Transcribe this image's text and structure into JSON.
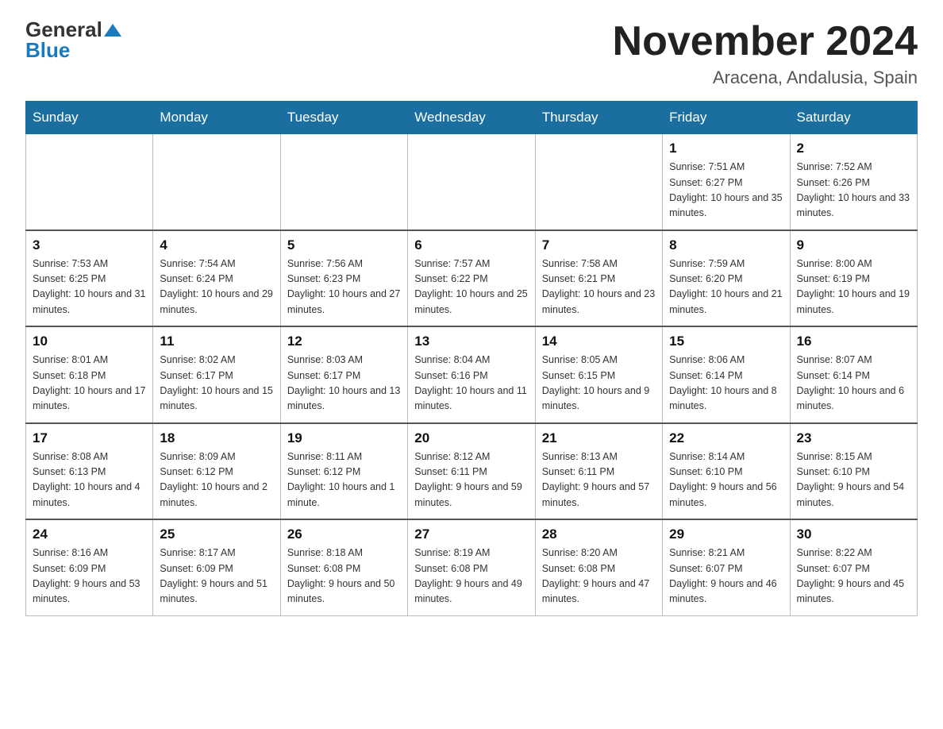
{
  "header": {
    "logo_general": "General",
    "logo_blue": "Blue",
    "month": "November 2024",
    "location": "Aracena, Andalusia, Spain"
  },
  "weekdays": [
    "Sunday",
    "Monday",
    "Tuesday",
    "Wednesday",
    "Thursday",
    "Friday",
    "Saturday"
  ],
  "weeks": [
    [
      {
        "day": "",
        "info": ""
      },
      {
        "day": "",
        "info": ""
      },
      {
        "day": "",
        "info": ""
      },
      {
        "day": "",
        "info": ""
      },
      {
        "day": "",
        "info": ""
      },
      {
        "day": "1",
        "info": "Sunrise: 7:51 AM\nSunset: 6:27 PM\nDaylight: 10 hours and 35 minutes."
      },
      {
        "day": "2",
        "info": "Sunrise: 7:52 AM\nSunset: 6:26 PM\nDaylight: 10 hours and 33 minutes."
      }
    ],
    [
      {
        "day": "3",
        "info": "Sunrise: 7:53 AM\nSunset: 6:25 PM\nDaylight: 10 hours and 31 minutes."
      },
      {
        "day": "4",
        "info": "Sunrise: 7:54 AM\nSunset: 6:24 PM\nDaylight: 10 hours and 29 minutes."
      },
      {
        "day": "5",
        "info": "Sunrise: 7:56 AM\nSunset: 6:23 PM\nDaylight: 10 hours and 27 minutes."
      },
      {
        "day": "6",
        "info": "Sunrise: 7:57 AM\nSunset: 6:22 PM\nDaylight: 10 hours and 25 minutes."
      },
      {
        "day": "7",
        "info": "Sunrise: 7:58 AM\nSunset: 6:21 PM\nDaylight: 10 hours and 23 minutes."
      },
      {
        "day": "8",
        "info": "Sunrise: 7:59 AM\nSunset: 6:20 PM\nDaylight: 10 hours and 21 minutes."
      },
      {
        "day": "9",
        "info": "Sunrise: 8:00 AM\nSunset: 6:19 PM\nDaylight: 10 hours and 19 minutes."
      }
    ],
    [
      {
        "day": "10",
        "info": "Sunrise: 8:01 AM\nSunset: 6:18 PM\nDaylight: 10 hours and 17 minutes."
      },
      {
        "day": "11",
        "info": "Sunrise: 8:02 AM\nSunset: 6:17 PM\nDaylight: 10 hours and 15 minutes."
      },
      {
        "day": "12",
        "info": "Sunrise: 8:03 AM\nSunset: 6:17 PM\nDaylight: 10 hours and 13 minutes."
      },
      {
        "day": "13",
        "info": "Sunrise: 8:04 AM\nSunset: 6:16 PM\nDaylight: 10 hours and 11 minutes."
      },
      {
        "day": "14",
        "info": "Sunrise: 8:05 AM\nSunset: 6:15 PM\nDaylight: 10 hours and 9 minutes."
      },
      {
        "day": "15",
        "info": "Sunrise: 8:06 AM\nSunset: 6:14 PM\nDaylight: 10 hours and 8 minutes."
      },
      {
        "day": "16",
        "info": "Sunrise: 8:07 AM\nSunset: 6:14 PM\nDaylight: 10 hours and 6 minutes."
      }
    ],
    [
      {
        "day": "17",
        "info": "Sunrise: 8:08 AM\nSunset: 6:13 PM\nDaylight: 10 hours and 4 minutes."
      },
      {
        "day": "18",
        "info": "Sunrise: 8:09 AM\nSunset: 6:12 PM\nDaylight: 10 hours and 2 minutes."
      },
      {
        "day": "19",
        "info": "Sunrise: 8:11 AM\nSunset: 6:12 PM\nDaylight: 10 hours and 1 minute."
      },
      {
        "day": "20",
        "info": "Sunrise: 8:12 AM\nSunset: 6:11 PM\nDaylight: 9 hours and 59 minutes."
      },
      {
        "day": "21",
        "info": "Sunrise: 8:13 AM\nSunset: 6:11 PM\nDaylight: 9 hours and 57 minutes."
      },
      {
        "day": "22",
        "info": "Sunrise: 8:14 AM\nSunset: 6:10 PM\nDaylight: 9 hours and 56 minutes."
      },
      {
        "day": "23",
        "info": "Sunrise: 8:15 AM\nSunset: 6:10 PM\nDaylight: 9 hours and 54 minutes."
      }
    ],
    [
      {
        "day": "24",
        "info": "Sunrise: 8:16 AM\nSunset: 6:09 PM\nDaylight: 9 hours and 53 minutes."
      },
      {
        "day": "25",
        "info": "Sunrise: 8:17 AM\nSunset: 6:09 PM\nDaylight: 9 hours and 51 minutes."
      },
      {
        "day": "26",
        "info": "Sunrise: 8:18 AM\nSunset: 6:08 PM\nDaylight: 9 hours and 50 minutes."
      },
      {
        "day": "27",
        "info": "Sunrise: 8:19 AM\nSunset: 6:08 PM\nDaylight: 9 hours and 49 minutes."
      },
      {
        "day": "28",
        "info": "Sunrise: 8:20 AM\nSunset: 6:08 PM\nDaylight: 9 hours and 47 minutes."
      },
      {
        "day": "29",
        "info": "Sunrise: 8:21 AM\nSunset: 6:07 PM\nDaylight: 9 hours and 46 minutes."
      },
      {
        "day": "30",
        "info": "Sunrise: 8:22 AM\nSunset: 6:07 PM\nDaylight: 9 hours and 45 minutes."
      }
    ]
  ]
}
